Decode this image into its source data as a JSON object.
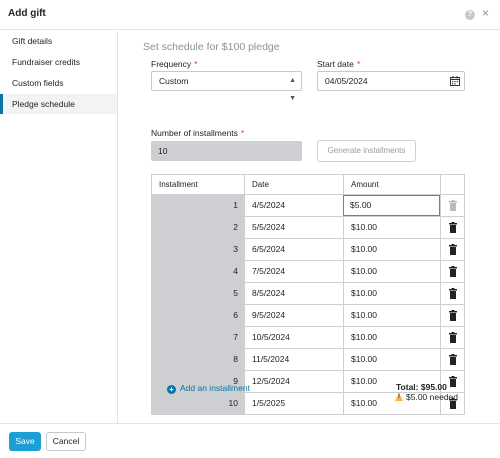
{
  "window": {
    "title": "Add gift",
    "help_glyph": "?",
    "close_glyph": "×"
  },
  "sidebar": {
    "items": [
      {
        "label": "Gift details",
        "active": false
      },
      {
        "label": "Fundraiser credits",
        "active": false
      },
      {
        "label": "Custom fields",
        "active": false
      },
      {
        "label": "Pledge schedule",
        "active": true
      }
    ]
  },
  "main": {
    "title": "Set schedule for $100 pledge",
    "frequency": {
      "label": "Frequency",
      "required_mark": "*",
      "value": "Custom"
    },
    "start_date": {
      "label": "Start date",
      "required_mark": "*",
      "value": "04/05/2024",
      "icon": "calendar-icon"
    },
    "installments_count": {
      "label": "Number of installments",
      "required_mark": "*",
      "value": "10"
    },
    "generate_button": "Generate installments",
    "table": {
      "columns": [
        "Installment",
        "Date",
        "Amount",
        ""
      ],
      "rows": [
        {
          "num": "1",
          "date": "4/5/2024",
          "amount": "$5.00"
        },
        {
          "num": "2",
          "date": "5/5/2024",
          "amount": "$10.00"
        },
        {
          "num": "3",
          "date": "6/5/2024",
          "amount": "$10.00"
        },
        {
          "num": "4",
          "date": "7/5/2024",
          "amount": "$10.00"
        },
        {
          "num": "5",
          "date": "8/5/2024",
          "amount": "$10.00"
        },
        {
          "num": "6",
          "date": "9/5/2024",
          "amount": "$10.00"
        },
        {
          "num": "7",
          "date": "10/5/2024",
          "amount": "$10.00"
        },
        {
          "num": "8",
          "date": "11/5/2024",
          "amount": "$10.00"
        },
        {
          "num": "9",
          "date": "12/5/2024",
          "amount": "$10.00"
        },
        {
          "num": "10",
          "date": "1/5/2025",
          "amount": "$10.00"
        }
      ]
    },
    "add_installment": "Add an installment",
    "total": "Total: $95.00",
    "needed": "$5.00 needed"
  },
  "footer": {
    "save": "Save",
    "cancel": "Cancel"
  },
  "colors": {
    "accent": "#1d9ed5",
    "link": "#0974a1",
    "warning": "#fbb933",
    "required": "#d93a3d"
  }
}
